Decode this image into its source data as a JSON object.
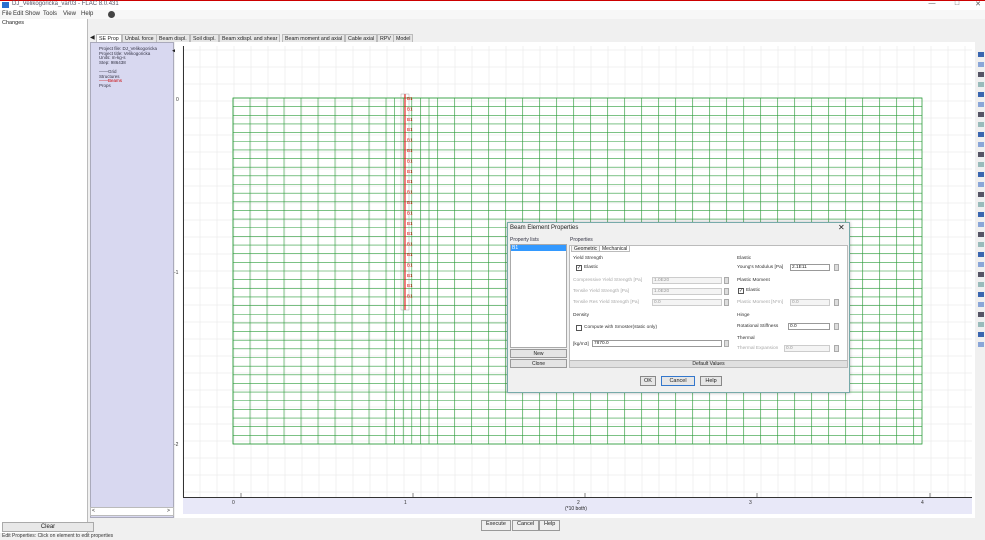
{
  "window": {
    "title": "DJ_Velikogoricka_var03 - FLAC 8.0.431",
    "controls": [
      "—",
      "□",
      "✕"
    ]
  },
  "menu": [
    "File",
    "Edit",
    "Show",
    "Tools",
    "View",
    "Help"
  ],
  "left_panel": {
    "title": "Changes",
    "clear_label": "Clear"
  },
  "status": "Edit Properties: Click on element to edit properties",
  "tabs": [
    "SE Prop",
    "Unbal. force",
    "Beam displ.",
    "Soil displ.",
    "Beam xdispl. and shear",
    "Beam moment and axial",
    "Cable axial",
    "RPV",
    "Model"
  ],
  "tree": {
    "lines": [
      "Project file: DJ_Velikogoricka",
      "Project title: Velikogoricka",
      "Units: m-kg-s",
      "Step: 986438",
      "",
      "——Grid",
      "Structures",
      "——Beams",
      "Props"
    ]
  },
  "plot": {
    "y_ticks": [
      "0",
      "-1",
      "-2"
    ],
    "x_ticks": [
      "0",
      "1",
      "2",
      "3",
      "4"
    ],
    "x_unit": "(*10 both)",
    "beam_label": "B1",
    "beam_label_count": 20,
    "grid_color": "#2e9d3c",
    "beam_color": "#e00000"
  },
  "bottom_buttons": {
    "execute": "Execute",
    "cancel": "Cancel",
    "help": "Help"
  },
  "dialog": {
    "title": "Beam Element Properties",
    "close": "✕",
    "property_lists_label": "Property lists",
    "selected_item": "B1",
    "new_label": "New",
    "clone_label": "Clone",
    "properties_label": "Properties",
    "tab_geometric": "Geometric",
    "tab_mechanical": "Mechanical",
    "yield_strength_label": "Yield Strength",
    "yield_elastic_label": "Elastic",
    "comp_yield_label": "Compressive Yield Strength [Pa]",
    "comp_yield_value": "1.0E20",
    "tensile_yield_label": "Tensile Yield Strength [Pa]",
    "tensile_yield_value": "1.0E20",
    "tensile_res_label": "Tensile Res Yield Strength [Pa]",
    "tensile_res_value": "0.0",
    "elastic_label": "Elastic",
    "youngs_label": "Young's Modulus [Pa]",
    "youngs_value": "2.1E11",
    "plastic_moment_label": "Plastic Moment",
    "plastic_elastic_label": "Elastic",
    "plastic_moment_field_label": "Plastic Moment [N*m]",
    "plastic_moment_value": "0.0",
    "density_label": "Density",
    "compute_label": "Compute with Smoster(static only)",
    "density_unit": "[kg/m3]",
    "density_value": "7870.0",
    "hinge_label": "Hinge",
    "rot_stiff_label": "Rotational Stiffness",
    "rot_stiff_value": "0.0",
    "thermal_label": "Thermal",
    "thermal_exp_label": "Thermal Expansion",
    "thermal_exp_value": "0.0",
    "default_values": "Default Values",
    "ok": "OK",
    "cancel": "Cancel",
    "help": "Help"
  }
}
